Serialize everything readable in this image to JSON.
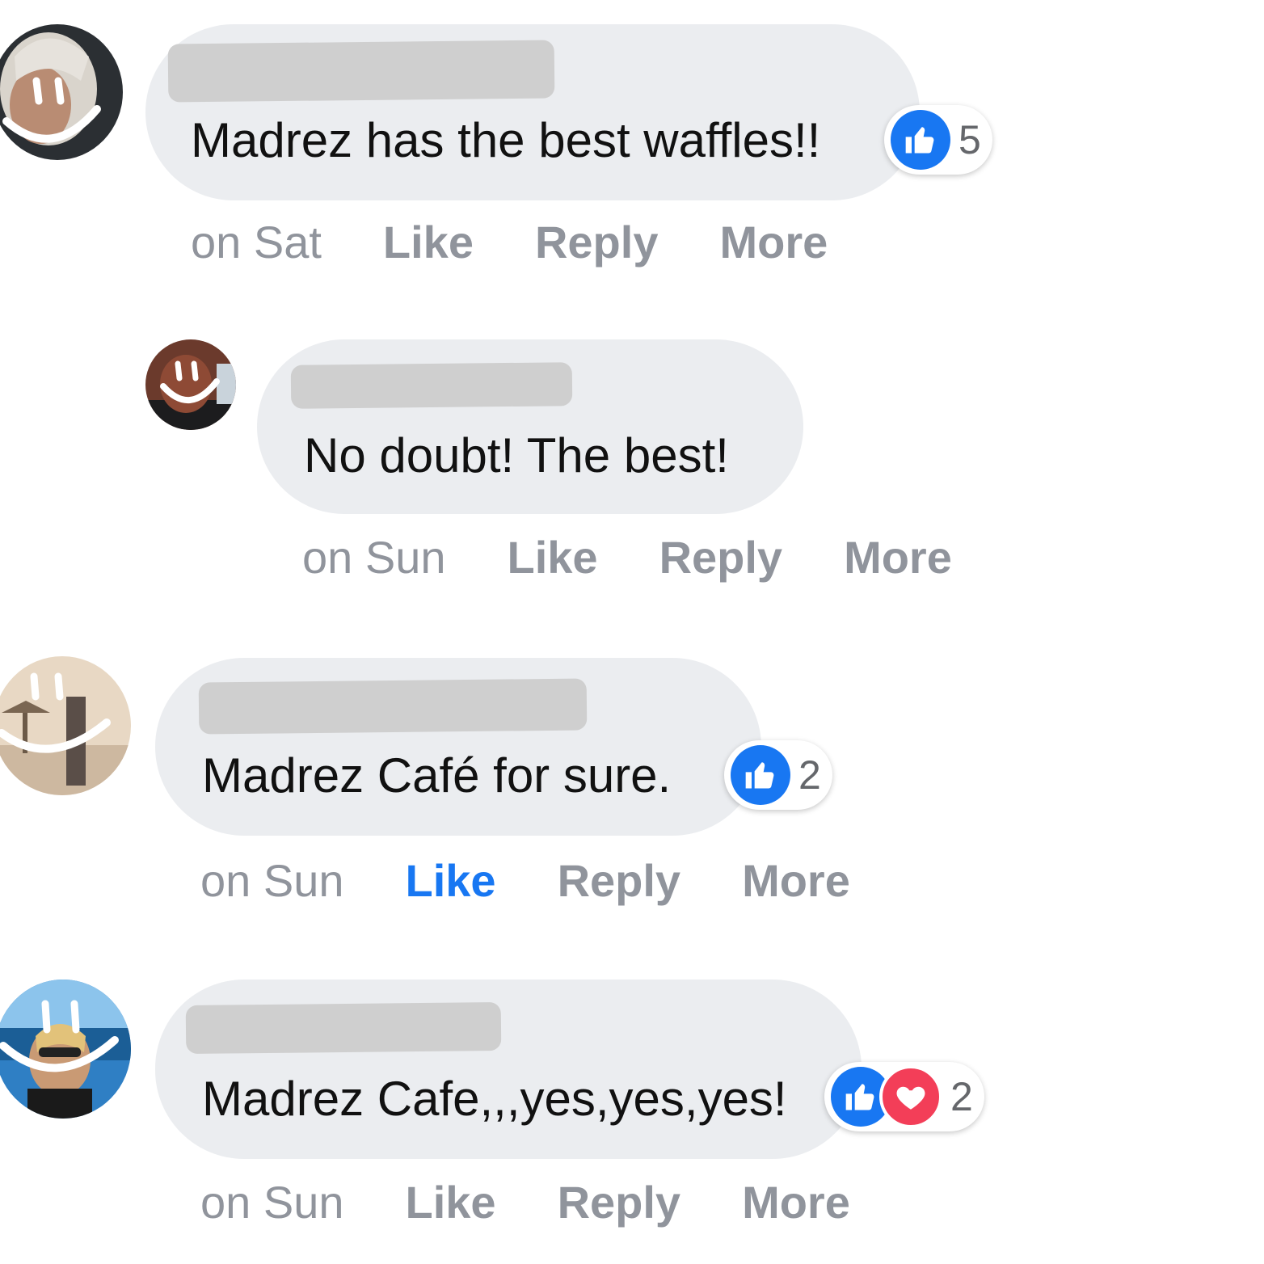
{
  "comments": [
    {
      "text": "Madrez has the best waffles!!",
      "reactions": {
        "types": [
          "like"
        ],
        "count": "5"
      },
      "time": "on Sat",
      "like_label": "Like",
      "reply_label": "Reply",
      "more_label": "More",
      "liked": false
    },
    {
      "text": "No doubt! The best!",
      "time": "on Sun",
      "like_label": "Like",
      "reply_label": "Reply",
      "more_label": "More",
      "liked": false
    },
    {
      "text": "Madrez Café for sure.",
      "reactions": {
        "types": [
          "like"
        ],
        "count": "2"
      },
      "time": "on Sun",
      "like_label": "Like",
      "reply_label": "Reply",
      "more_label": "More",
      "liked": true
    },
    {
      "text": "Madrez Cafe,,,yes,yes,yes!",
      "reactions": {
        "types": [
          "like",
          "love"
        ],
        "count": "2"
      },
      "time": "on Sun",
      "like_label": "Like",
      "reply_label": "Reply",
      "more_label": "More",
      "liked": false
    }
  ],
  "icons": {
    "like": "thumbs-up-icon",
    "love": "heart-icon"
  },
  "colors": {
    "bubble": "#ebedf0",
    "link_blue": "#1877f2",
    "meta_gray": "#90949c",
    "love_red": "#f33e58"
  }
}
